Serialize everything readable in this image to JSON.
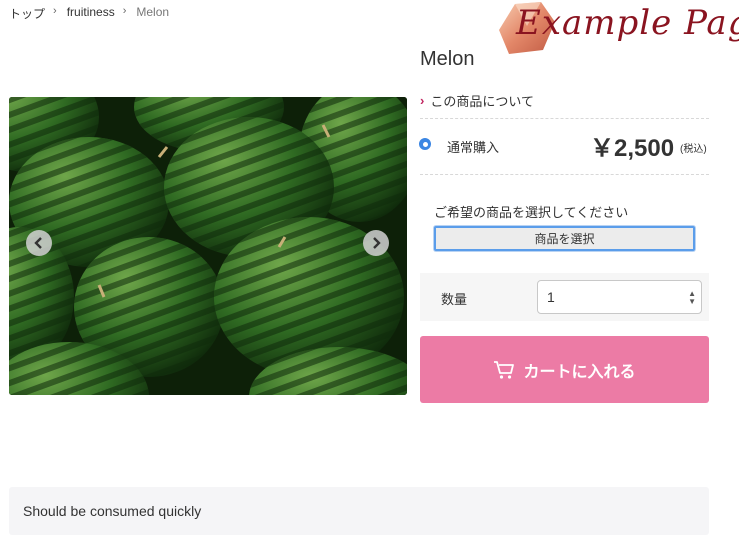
{
  "breadcrumb": {
    "items": [
      "トップ",
      "fruitiness",
      "Melon"
    ]
  },
  "logo": {
    "text": "Example Page"
  },
  "product": {
    "title": "Melon",
    "about_label": "この商品について",
    "purchase_type": "通常購入",
    "price": "￥2,500",
    "tax_note": "(税込)",
    "select_prompt": "ご希望の商品を選択してください",
    "select_button": "商品を選択",
    "quantity_label": "数量",
    "quantity_value": "1",
    "cart_button": "カートに入れる",
    "description": "Should be consumed quickly"
  },
  "icons": {
    "prev": "chevron-left-icon",
    "next": "chevron-right-icon",
    "cart": "cart-icon"
  },
  "colors": {
    "cart_button": "#ec7ba5",
    "accent_chevron": "#c12660",
    "radio": "#3b86e3",
    "logo": "#8a1420"
  }
}
